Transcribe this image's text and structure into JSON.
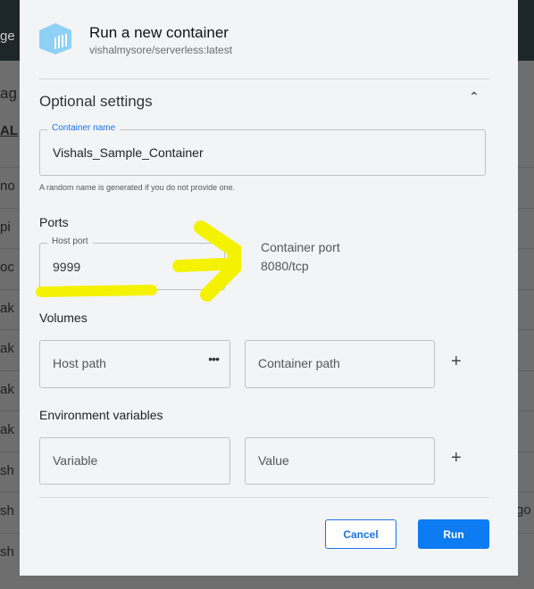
{
  "background": {
    "header_fragment": "ge",
    "title_fragment": "ag",
    "tab_fragment": "AL",
    "rows": [
      "no",
      "pi",
      "oc",
      "ak",
      "ak",
      "ak",
      "ak",
      "sh",
      "sh",
      "sh"
    ],
    "right_fragment": "go"
  },
  "dialog": {
    "title": "Run a new container",
    "image": "vishalmysore/serverless:latest",
    "optional_settings": "Optional settings",
    "container_name": {
      "label": "Container name",
      "value": "Vishals_Sample_Container",
      "hint": "A random name is generated if you do not provide one."
    },
    "ports": {
      "heading": "Ports",
      "host_label": "Host port",
      "host_value": "9999",
      "container_label": "Container port",
      "container_value": "8080/tcp"
    },
    "volumes": {
      "heading": "Volumes",
      "host_placeholder": "Host path",
      "container_placeholder": "Container path"
    },
    "env": {
      "heading": "Environment variables",
      "variable_placeholder": "Variable",
      "value_placeholder": "Value"
    },
    "cancel": "Cancel",
    "run": "Run"
  },
  "colors": {
    "accent": "#0d7bf2",
    "annotation": "#f5f200"
  }
}
